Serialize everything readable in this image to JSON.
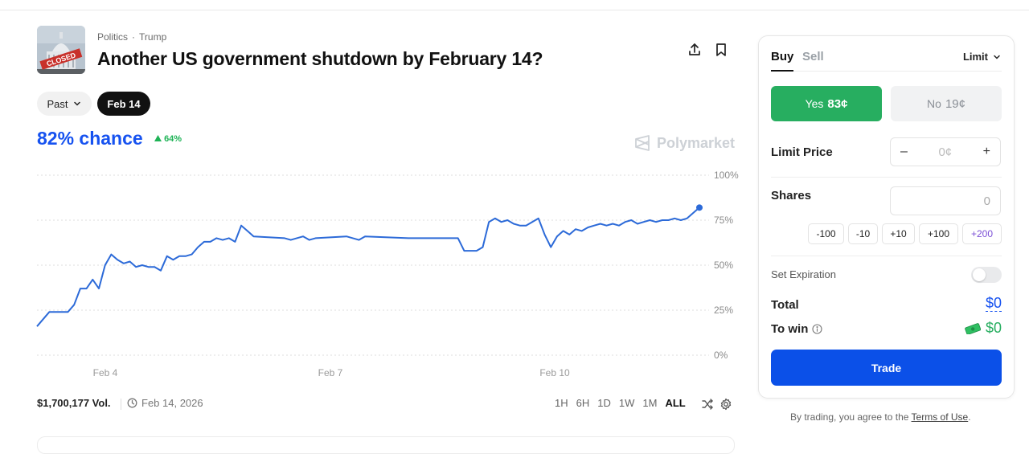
{
  "header": {
    "category": "Politics",
    "subcategory": "Trump",
    "title": "Another US government shutdown by February 14?",
    "thumbnail_text": "CLOSED"
  },
  "pills": {
    "past": "Past",
    "date": "Feb 14"
  },
  "odds": {
    "chance": "82% chance",
    "delta": "64%"
  },
  "brand": "Polymarket",
  "chart_data": {
    "type": "line",
    "ylabels": [
      "100%",
      "75%",
      "50%",
      "25%",
      "0%"
    ],
    "ylim": [
      0,
      100
    ],
    "xlabels": [
      "Feb 4",
      "Feb 7",
      "Feb 10"
    ],
    "grid": true,
    "series": [
      {
        "color": "#2c6ad8",
        "values": [
          [
            0,
            16
          ],
          [
            1,
            20
          ],
          [
            2,
            24
          ],
          [
            5,
            24
          ],
          [
            6,
            28
          ],
          [
            7,
            37
          ],
          [
            8,
            37
          ],
          [
            9,
            42
          ],
          [
            10,
            37
          ],
          [
            11,
            50
          ],
          [
            12,
            56
          ],
          [
            13,
            53
          ],
          [
            14,
            51
          ],
          [
            15,
            52
          ],
          [
            16,
            49
          ],
          [
            17,
            50
          ],
          [
            18,
            49
          ],
          [
            19,
            49
          ],
          [
            20,
            47
          ],
          [
            21,
            55
          ],
          [
            22,
            53
          ],
          [
            23,
            55
          ],
          [
            24,
            55
          ],
          [
            25,
            56
          ],
          [
            26,
            60
          ],
          [
            27,
            63
          ],
          [
            28,
            63
          ],
          [
            29,
            65
          ],
          [
            30,
            64
          ],
          [
            31,
            65
          ],
          [
            32,
            63
          ],
          [
            33,
            72
          ],
          [
            34,
            69
          ],
          [
            35,
            66
          ],
          [
            40,
            65
          ],
          [
            41,
            64
          ],
          [
            43,
            66
          ],
          [
            44,
            64
          ],
          [
            45,
            65
          ],
          [
            50,
            66
          ],
          [
            52,
            64
          ],
          [
            53,
            66
          ],
          [
            60,
            65
          ],
          [
            62,
            65
          ],
          [
            68,
            65
          ],
          [
            69,
            58
          ],
          [
            70,
            58
          ],
          [
            71,
            58
          ],
          [
            72,
            60
          ],
          [
            73,
            74
          ],
          [
            74,
            76
          ],
          [
            75,
            74
          ],
          [
            76,
            75
          ],
          [
            77,
            73
          ],
          [
            78,
            72
          ],
          [
            79,
            72
          ],
          [
            80,
            74
          ],
          [
            81,
            76
          ],
          [
            82,
            67
          ],
          [
            83,
            60
          ],
          [
            84,
            66
          ],
          [
            85,
            69
          ],
          [
            86,
            67
          ],
          [
            87,
            70
          ],
          [
            88,
            69
          ],
          [
            89,
            71
          ],
          [
            90,
            72
          ],
          [
            91,
            73
          ],
          [
            92,
            72
          ],
          [
            93,
            73
          ],
          [
            94,
            72
          ],
          [
            95,
            74
          ],
          [
            96,
            75
          ],
          [
            97,
            73
          ],
          [
            98,
            74
          ],
          [
            99,
            75
          ],
          [
            100,
            74
          ],
          [
            101,
            75
          ],
          [
            102,
            75
          ],
          [
            103,
            76
          ],
          [
            104,
            75
          ],
          [
            105,
            76
          ],
          [
            106,
            79
          ],
          [
            107,
            82
          ]
        ]
      }
    ]
  },
  "footer": {
    "volume": "$1,700,177 Vol.",
    "end_date": "Feb 14, 2026",
    "ranges": [
      "1H",
      "6H",
      "1D",
      "1W",
      "1M",
      "ALL"
    ],
    "active_range": "ALL"
  },
  "trade": {
    "tab_buy": "Buy",
    "tab_sell": "Sell",
    "order_type": "Limit",
    "yes_label": "Yes",
    "yes_price": "83¢",
    "no_label": "No",
    "no_price": "19¢",
    "limit_label": "Limit Price",
    "limit_value": "0¢",
    "shares_label": "Shares",
    "shares_value": "0",
    "chips": [
      "-100",
      "-10",
      "+10",
      "+100",
      "+200"
    ],
    "expiration_label": "Set Expiration",
    "total_label": "Total",
    "total_value": "$0",
    "win_label": "To win",
    "win_value": "$0",
    "trade_button": "Trade"
  },
  "terms": {
    "prefix": "By trading, you agree to the ",
    "link": "Terms of Use",
    "suffix": "."
  },
  "colors": {
    "accent": "#1652f0",
    "yes": "#27ae60",
    "up": "#1eb356",
    "trade": "#0b50e8"
  }
}
